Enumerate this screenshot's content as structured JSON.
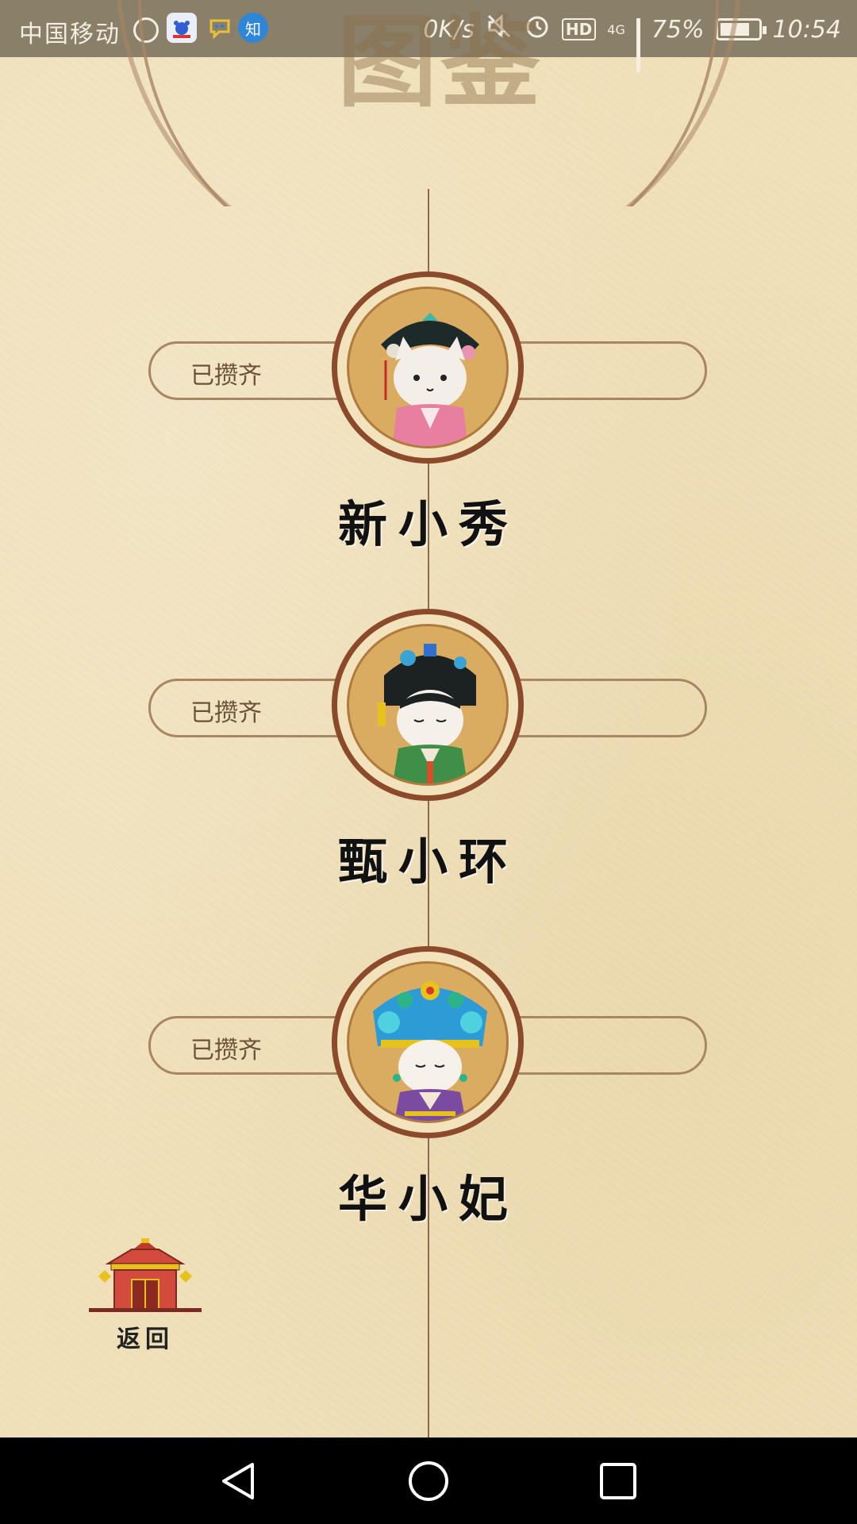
{
  "status_bar": {
    "carrier": "中国移动",
    "app_icon_zhihu": "知",
    "network_speed": "0K/s",
    "hd_badge": "HD",
    "network_type": "4G",
    "battery_percent": "75%",
    "time": "10:54"
  },
  "header": {
    "title": "图鉴"
  },
  "characters": [
    {
      "status": "已攒齐",
      "name": "新小秀",
      "robe_color": "#e87fa0"
    },
    {
      "status": "已攒齐",
      "name": "甄小环",
      "robe_color": "#3f8f48"
    },
    {
      "status": "已攒齐",
      "name": "华小妃",
      "robe_color": "#7a4ba0"
    }
  ],
  "back_button": {
    "label": "返回"
  },
  "colors": {
    "paper": "#f0e0b9",
    "frame": "#8b4a2b",
    "portrait_bg": "#d9ac62",
    "navbar": "#000000"
  }
}
